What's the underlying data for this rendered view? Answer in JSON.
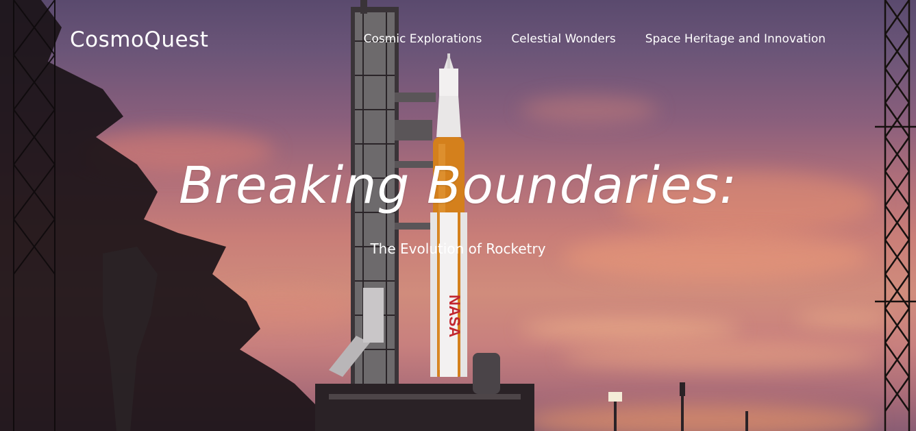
{
  "brand": {
    "name": "CosmoQuest"
  },
  "nav": {
    "items": [
      {
        "label": "Cosmic Explorations"
      },
      {
        "label": "Celestial Wonders"
      },
      {
        "label": "Space Heritage and Innovation"
      }
    ]
  },
  "hero": {
    "title": "Breaking Boundaries:",
    "subtitle": "The Evolution of Rocketry",
    "background_image": "rocket-on-launchpad-at-sunset",
    "rocket_label": "NASA"
  },
  "colors": {
    "text": "#ffffff",
    "sky_top": "#5a4a6e",
    "sky_mid": "#c97e78",
    "rocket_orange": "#d4801c",
    "silhouette": "#1b1418"
  }
}
